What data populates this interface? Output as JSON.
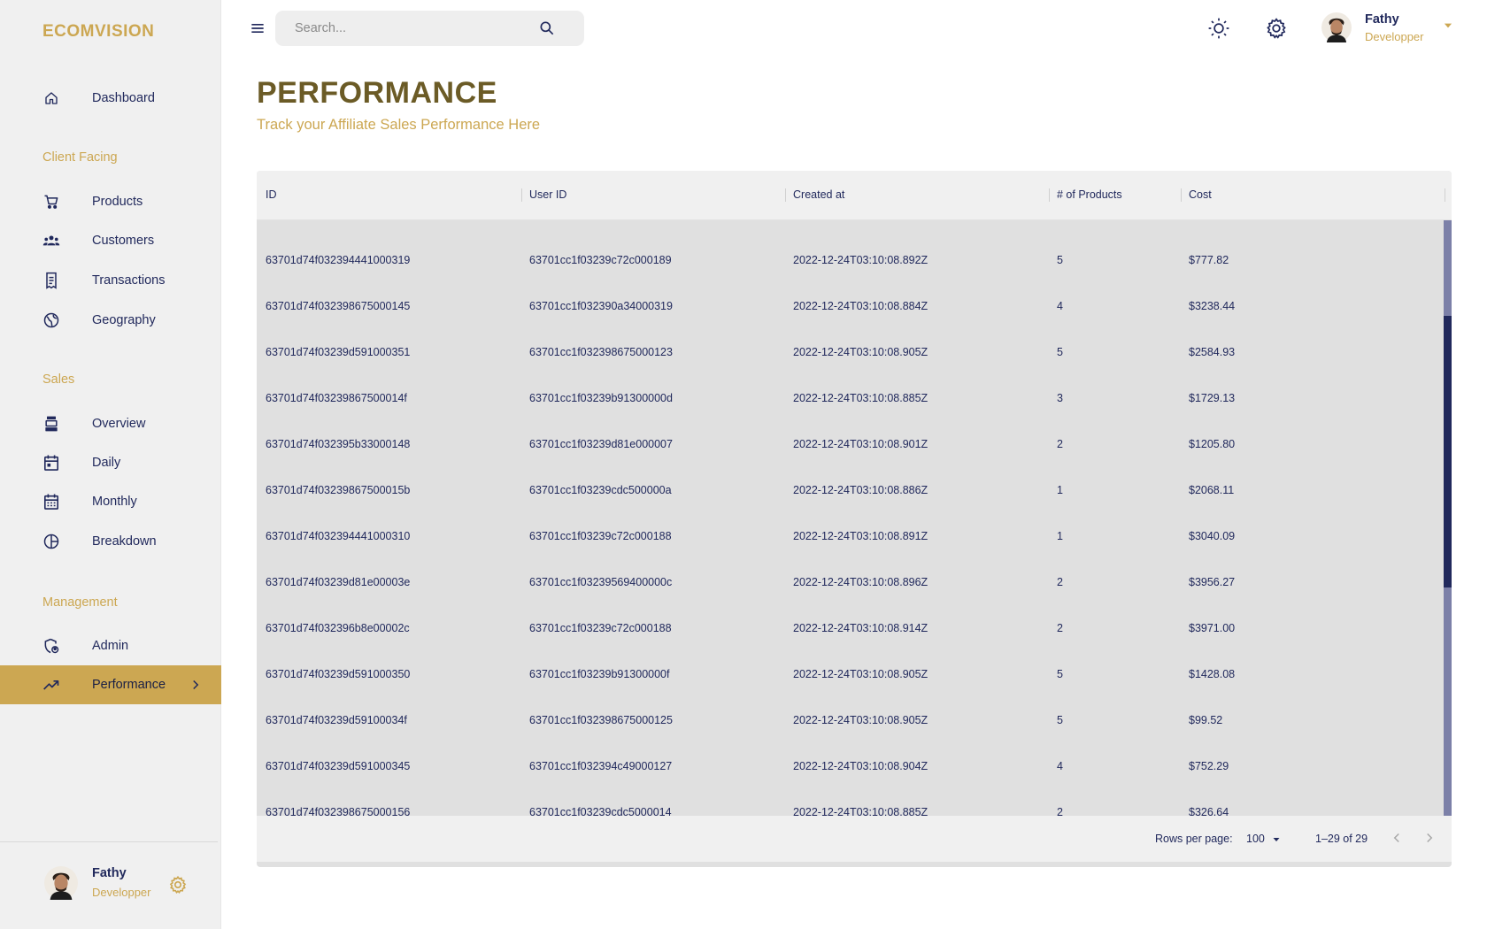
{
  "brand": "ECOMVISION",
  "nav": {
    "dashboard": "Dashboard",
    "client_facing": "Client Facing",
    "products": "Products",
    "customers": "Customers",
    "transactions": "Transactions",
    "geography": "Geography",
    "sales": "Sales",
    "overview": "Overview",
    "daily": "Daily",
    "monthly": "Monthly",
    "breakdown": "Breakdown",
    "management": "Management",
    "admin": "Admin",
    "performance": "Performance"
  },
  "sidebar_user": {
    "name": "Fathy",
    "role": "Developper"
  },
  "topbar": {
    "search_placeholder": "Search...",
    "user": {
      "name": "Fathy",
      "role": "Developper"
    }
  },
  "header": {
    "title": "PERFORMANCE",
    "subtitle": "Track your Affiliate Sales Performance Here"
  },
  "table": {
    "columns": [
      "ID",
      "User ID",
      "Created at",
      "# of Products",
      "Cost"
    ],
    "rows": [
      [
        "63701d74f032394441000319",
        "63701cc1f03239c72c000189",
        "2022-12-24T03:10:08.892Z",
        "5",
        "$777.82"
      ],
      [
        "63701d74f032398675000145",
        "63701cc1f032390a34000319",
        "2022-12-24T03:10:08.884Z",
        "4",
        "$3238.44"
      ],
      [
        "63701d74f03239d591000351",
        "63701cc1f032398675000123",
        "2022-12-24T03:10:08.905Z",
        "5",
        "$2584.93"
      ],
      [
        "63701d74f03239867500014f",
        "63701cc1f03239b91300000d",
        "2022-12-24T03:10:08.885Z",
        "3",
        "$1729.13"
      ],
      [
        "63701d74f032395b33000148",
        "63701cc1f03239d81e000007",
        "2022-12-24T03:10:08.901Z",
        "2",
        "$1205.80"
      ],
      [
        "63701d74f03239867500015b",
        "63701cc1f03239cdc500000a",
        "2022-12-24T03:10:08.886Z",
        "1",
        "$2068.11"
      ],
      [
        "63701d74f032394441000310",
        "63701cc1f03239c72c000188",
        "2022-12-24T03:10:08.891Z",
        "1",
        "$3040.09"
      ],
      [
        "63701d74f03239d81e00003e",
        "63701cc1f03239569400000c",
        "2022-12-24T03:10:08.896Z",
        "2",
        "$3956.27"
      ],
      [
        "63701d74f032396b8e00002c",
        "63701cc1f03239c72c000188",
        "2022-12-24T03:10:08.914Z",
        "2",
        "$3971.00"
      ],
      [
        "63701d74f03239d591000350",
        "63701cc1f03239b91300000f",
        "2022-12-24T03:10:08.905Z",
        "5",
        "$1428.08"
      ],
      [
        "63701d74f03239d59100034f",
        "63701cc1f032398675000125",
        "2022-12-24T03:10:08.905Z",
        "5",
        "$99.52"
      ],
      [
        "63701d74f03239d591000345",
        "63701cc1f032394c49000127",
        "2022-12-24T03:10:08.904Z",
        "4",
        "$752.29"
      ],
      [
        "63701d74f032398675000156",
        "63701cc1f03239cdc5000014",
        "2022-12-24T03:10:08.885Z",
        "2",
        "$326.64"
      ]
    ],
    "footer": {
      "rows_per_page_label": "Rows per page:",
      "rows_per_page_value": "100",
      "range": "1–29 of 29"
    }
  },
  "colors": {
    "accent": "#cca752",
    "primary": "#21295c",
    "title": "#6b5b26",
    "sidebar_bg": "#f0f0f0",
    "grid_bg": "#e0e0e0",
    "scroll_thumb": "#21295c"
  },
  "icons": [
    "menu-icon",
    "search-icon",
    "sun-icon",
    "gear-icon",
    "chevron-down-icon",
    "home-icon",
    "cart-icon",
    "groups-icon",
    "receipt-icon",
    "globe-icon",
    "point-of-sale-icon",
    "calendar-today-icon",
    "calendar-month-icon",
    "pie-chart-icon",
    "admin-icon",
    "trending-up-icon",
    "chevron-right-icon",
    "chevron-left-icon"
  ]
}
